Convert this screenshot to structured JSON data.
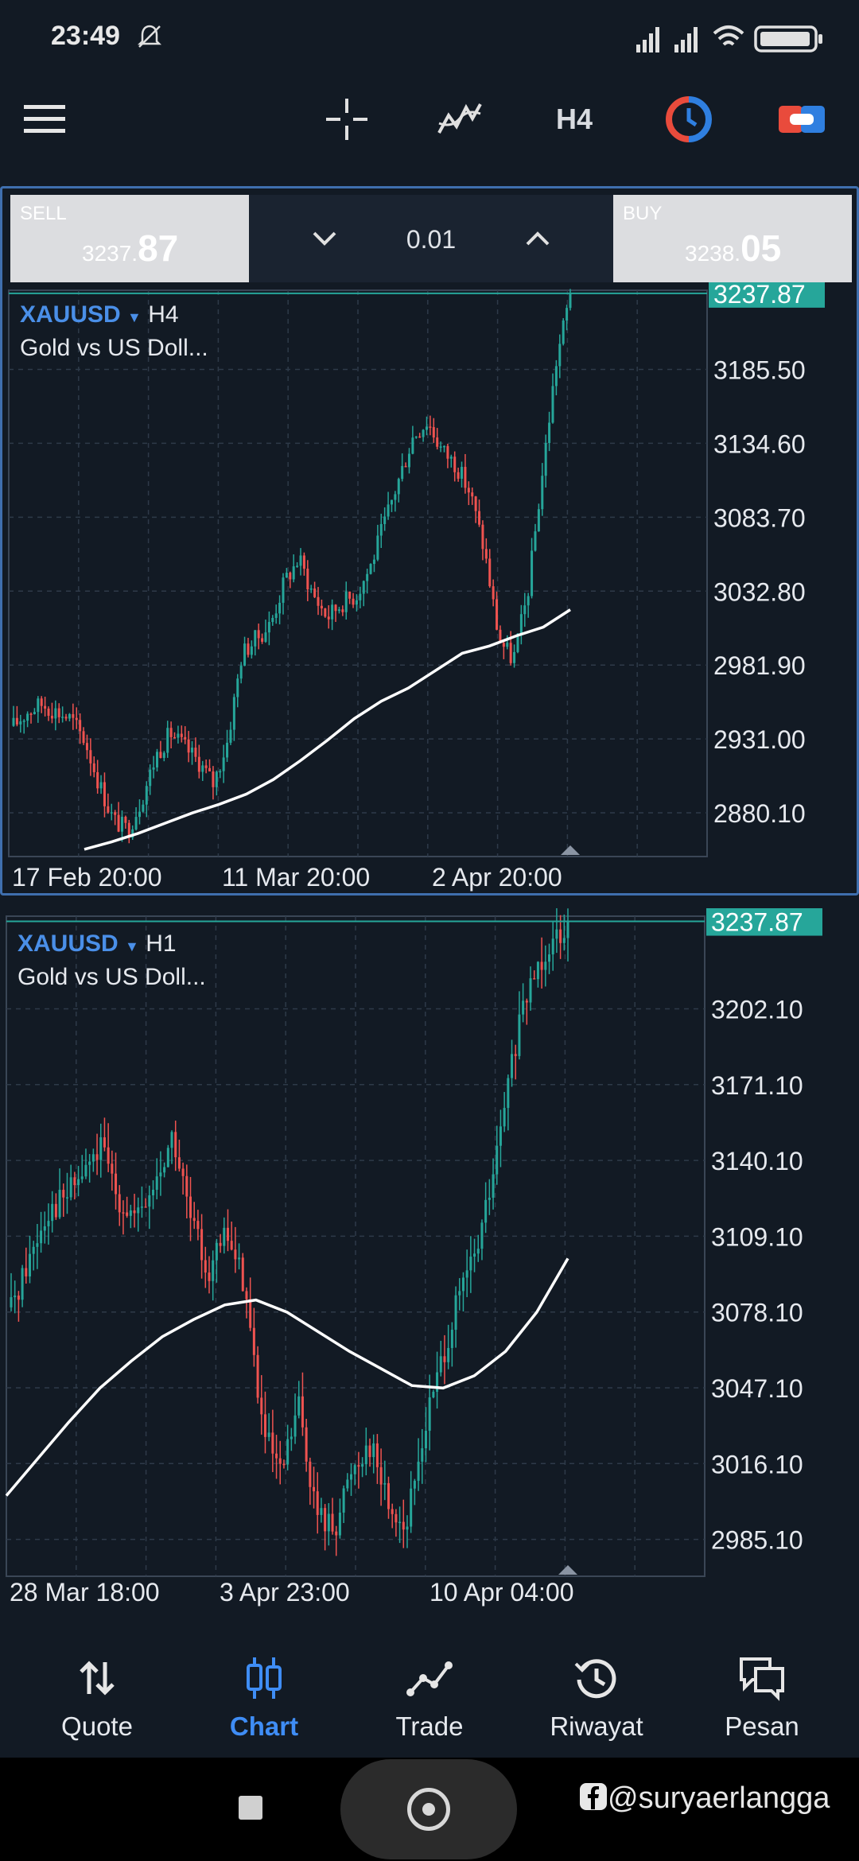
{
  "status": {
    "time": "23:49"
  },
  "toolbar": {
    "timeframe": "H4",
    "icons": [
      "menu-icon",
      "crosshair-icon",
      "indicator-icon",
      "timeframe",
      "clock-icon",
      "trade-toggle-icon"
    ]
  },
  "trade": {
    "sell_label": "SELL",
    "sell_price_small": "3237.",
    "sell_price_big": "87",
    "buy_label": "BUY",
    "buy_price_small": "3238.",
    "buy_price_big": "05",
    "lot": "0.01"
  },
  "chart_top": {
    "symbol": "XAUUSD",
    "timeframe": "H4",
    "description": "Gold vs US Doll...",
    "current_price": "3237.87",
    "price_ticks": [
      "3185.50",
      "3134.60",
      "3083.70",
      "3032.80",
      "2981.90",
      "2931.00",
      "2880.10"
    ],
    "time_labels": [
      "17 Feb 20:00",
      "11 Mar 20:00",
      "2 Apr 20:00"
    ]
  },
  "chart_bottom": {
    "symbol": "XAUUSD",
    "timeframe": "H1",
    "description": "Gold vs US Doll...",
    "current_price": "3237.87",
    "price_ticks": [
      "3202.10",
      "3171.10",
      "3140.10",
      "3109.10",
      "3078.10",
      "3047.10",
      "3016.10",
      "2985.10"
    ],
    "time_labels": [
      "28 Mar 18:00",
      "3 Apr 23:00",
      "10 Apr 04:00"
    ]
  },
  "chart_data": [
    {
      "type": "line",
      "title": "XAUUSD H4",
      "series": [
        {
          "name": "",
          "values": [
            2940,
            2950,
            2955,
            2950,
            2945,
            2930,
            2900,
            2875,
            2868,
            2890,
            2920,
            2935,
            2925,
            2915,
            2900,
            2930,
            2990,
            3000,
            3010,
            3040,
            3055,
            3030,
            3015,
            3025,
            3030,
            3050,
            3080,
            3110,
            3140,
            3150,
            3130,
            3120,
            3100,
            3060,
            3000,
            2985,
            3030,
            3110,
            3190,
            3237.87
          ]
        },
        {
          "name": "",
          "values": [
            2855,
            2860,
            2866,
            2873,
            2880,
            2886,
            2893,
            2903,
            2916,
            2930,
            2945,
            2957,
            2966,
            2978,
            2990,
            2995,
            3002,
            3008,
            3020
          ]
        }
      ],
      "x_labels": [
        "17 Feb 20:00",
        "11 Mar 20:00",
        "2 Apr 20:00"
      ],
      "ylim": [
        2850,
        3240
      ],
      "grid": true
    },
    {
      "type": "line",
      "title": "XAUUSD H1",
      "series": [
        {
          "name": "",
          "values": [
            3080,
            3100,
            3120,
            3125,
            3135,
            3145,
            3125,
            3115,
            3130,
            3150,
            3115,
            3095,
            3110,
            3090,
            3030,
            3010,
            3040,
            2995,
            2990,
            3015,
            3025,
            3000,
            2990,
            3030,
            3060,
            3085,
            3105,
            3140,
            3185,
            3215,
            3230,
            3237.87
          ]
        },
        {
          "name": "",
          "values": [
            3003,
            3018,
            3033,
            3047,
            3058,
            3068,
            3075,
            3081,
            3083,
            3078,
            3070,
            3062,
            3055,
            3048,
            3047,
            3052,
            3062,
            3078,
            3100
          ]
        }
      ],
      "x_labels": [
        "28 Mar 18:00",
        "3 Apr 23:00",
        "10 Apr 04:00"
      ],
      "ylim": [
        2970,
        3240
      ],
      "grid": true
    }
  ],
  "nav": {
    "items": [
      {
        "label": "Quote",
        "icon": "quote-icon"
      },
      {
        "label": "Chart",
        "icon": "chart-icon"
      },
      {
        "label": "Trade",
        "icon": "trade-icon"
      },
      {
        "label": "Riwayat",
        "icon": "history-icon"
      },
      {
        "label": "Pesan",
        "icon": "message-icon"
      }
    ]
  },
  "watermark": "@suryaerlangga",
  "colors": {
    "bg": "#121a24",
    "up": "#26a69a",
    "down": "#ef5350",
    "accent": "#3f8df5",
    "price_tag": "#26a69a"
  }
}
